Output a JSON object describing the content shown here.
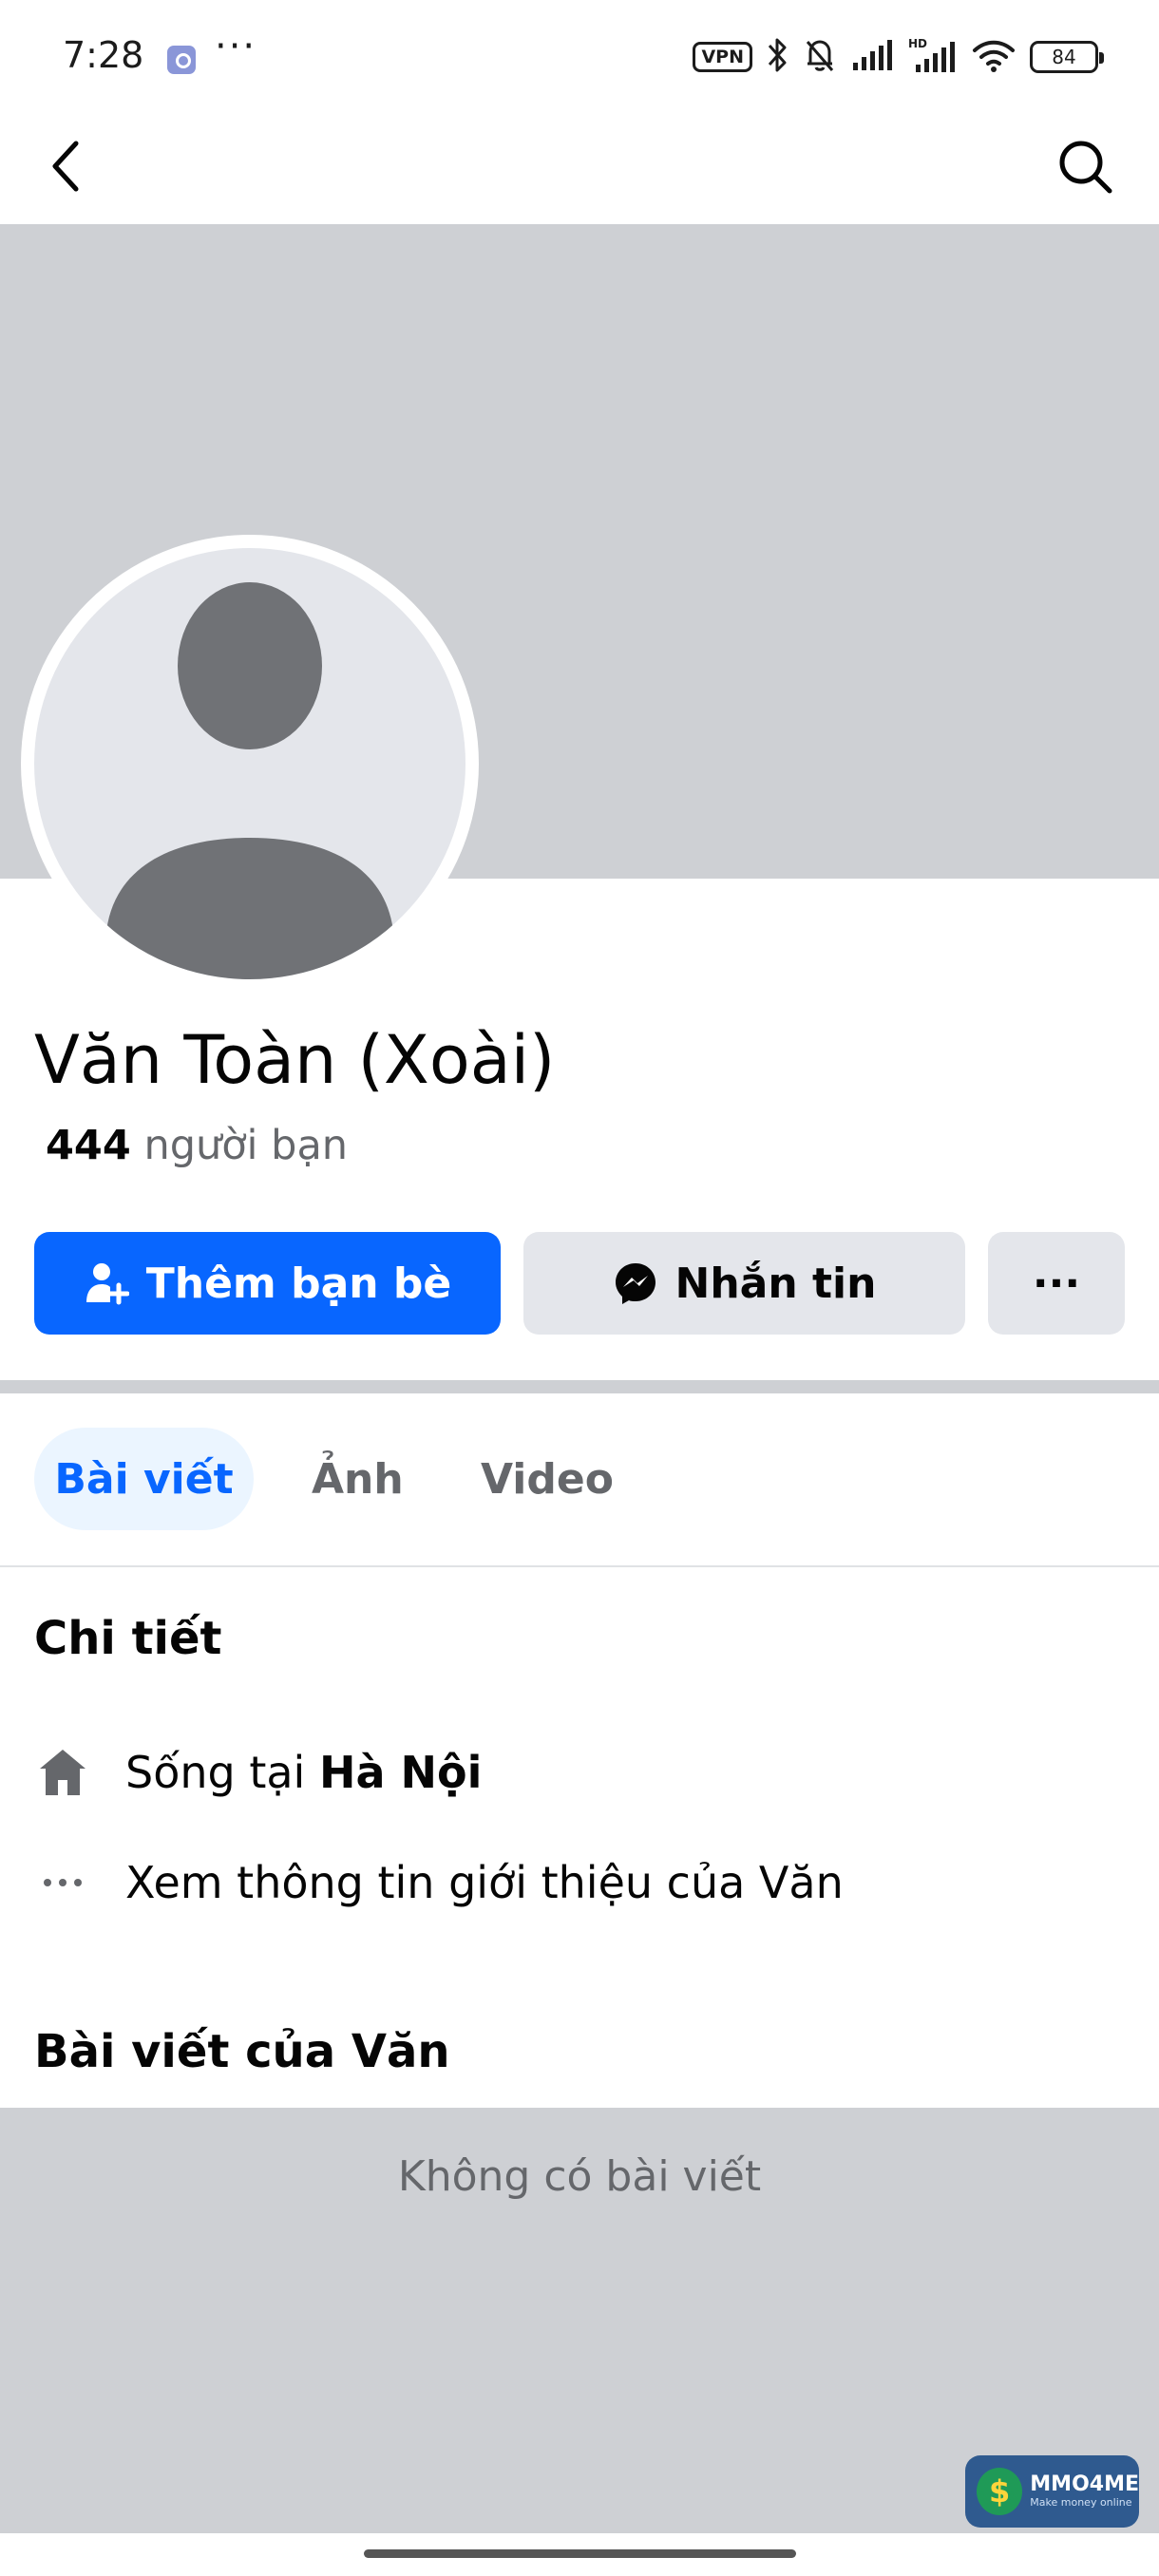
{
  "status_bar": {
    "time": "7:28",
    "overflow": "···",
    "vpn": "VPN",
    "battery": "84",
    "icons": [
      "app-notification-icon",
      "bluetooth-icon",
      "mute-bell-icon",
      "signal-icon",
      "hd-signal-icon",
      "wifi-icon",
      "battery-icon"
    ]
  },
  "nav": {
    "back_icon": "chevron-left-icon",
    "search_icon": "search-icon"
  },
  "profile": {
    "name": "Văn Toàn (Xoài)",
    "friends_count": "444",
    "friends_label": "người bạn"
  },
  "actions": {
    "add_friend": "Thêm bạn bè",
    "message": "Nhắn tin",
    "more": "···"
  },
  "tabs": [
    {
      "label": "Bài viết",
      "active": true
    },
    {
      "label": "Ảnh",
      "active": false
    },
    {
      "label": "Video",
      "active": false
    }
  ],
  "details": {
    "title": "Chi tiết",
    "lives_prefix": "Sống tại",
    "lives_city": "Hà Nội",
    "about_link": "Xem thông tin giới thiệu của Văn"
  },
  "posts": {
    "title": "Bài viết của Văn",
    "empty": "Không có bài viết"
  },
  "watermark": {
    "brand": "MMO4ME",
    "tagline": "Make money online"
  },
  "colors": {
    "accent": "#0866ff",
    "tab_active_bg": "#ebf5ff",
    "button_secondary": "#e4e6eb",
    "cover": "#ced0d4",
    "avatar_silhouette": "#707276"
  }
}
